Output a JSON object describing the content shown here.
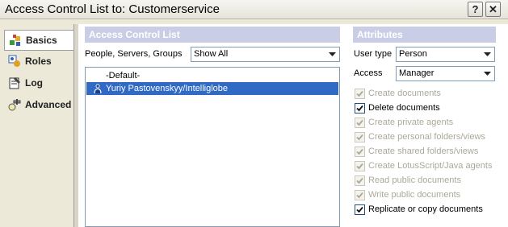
{
  "window": {
    "title": "Access Control List to: Customerservice",
    "help_glyph": "?",
    "close_glyph": "✕"
  },
  "nav": {
    "items": [
      {
        "label": "Basics",
        "icon": "basics-icon",
        "active": true
      },
      {
        "label": "Roles",
        "icon": "roles-icon",
        "active": false
      },
      {
        "label": "Log",
        "icon": "log-icon",
        "active": false
      },
      {
        "label": "Advanced",
        "icon": "advanced-icon",
        "active": false
      }
    ]
  },
  "acl": {
    "header": "Access Control List",
    "filter_label": "People, Servers, Groups",
    "filter_value": "Show All",
    "entries": [
      {
        "label": "-Default-",
        "selected": false
      },
      {
        "label": "Yuriy Pastovenskyy/Intelliglobe",
        "selected": true,
        "icon": "person-icon"
      }
    ]
  },
  "attributes": {
    "header": "Attributes",
    "user_type_label": "User type",
    "user_type_value": "Person",
    "access_label": "Access",
    "access_value": "Manager",
    "permissions": [
      {
        "label": "Create documents",
        "checked": true,
        "enabled": false
      },
      {
        "label": "Delete documents",
        "checked": true,
        "enabled": true
      },
      {
        "label": "Create private agents",
        "checked": true,
        "enabled": false
      },
      {
        "label": "Create personal folders/views",
        "checked": true,
        "enabled": false
      },
      {
        "label": "Create shared folders/views",
        "checked": true,
        "enabled": false
      },
      {
        "label": "Create LotusScript/Java agents",
        "checked": true,
        "enabled": false
      },
      {
        "label": "Read public documents",
        "checked": true,
        "enabled": false
      },
      {
        "label": "Write public documents",
        "checked": true,
        "enabled": false
      },
      {
        "label": "Replicate or copy documents",
        "checked": true,
        "enabled": true
      }
    ]
  },
  "colors": {
    "section_header_bg": "#c9cde6",
    "selection_bg": "#316ac5",
    "dialog_bg": "#ece9d8"
  }
}
